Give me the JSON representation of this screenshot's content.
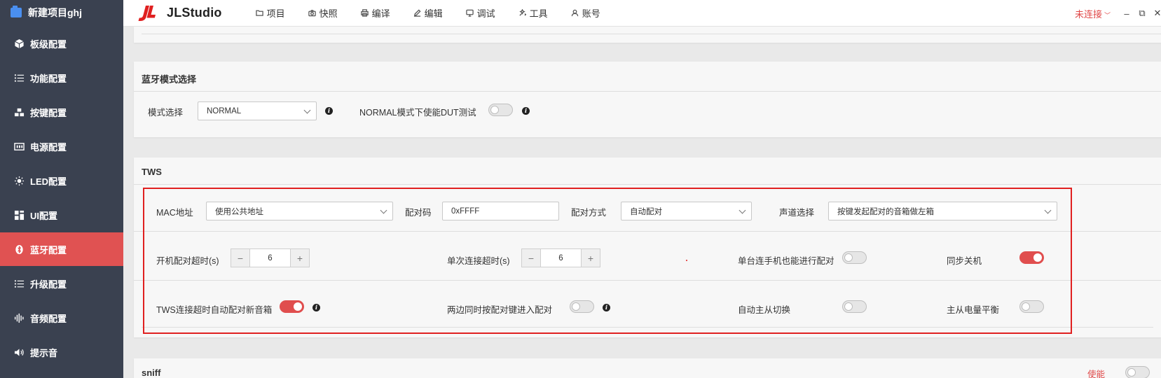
{
  "sidebar": {
    "project": "新建项目ghj",
    "items": [
      {
        "label": "板级配置",
        "icon": "cube-icon"
      },
      {
        "label": "功能配置",
        "icon": "list-icon"
      },
      {
        "label": "按键配置",
        "icon": "keys-icon"
      },
      {
        "label": "电源配置",
        "icon": "power-icon"
      },
      {
        "label": "LED配置",
        "icon": "led-icon"
      },
      {
        "label": "UI配置",
        "icon": "grid-icon"
      },
      {
        "label": "蓝牙配置",
        "icon": "bluetooth-icon",
        "active": true
      },
      {
        "label": "升级配置",
        "icon": "list-icon"
      },
      {
        "label": "音频配置",
        "icon": "audio-wave-icon"
      },
      {
        "label": "提示音",
        "icon": "speaker-icon"
      }
    ]
  },
  "header": {
    "app_name": "JLStudio",
    "menu": [
      {
        "label": "项目",
        "icon": "folder-icon"
      },
      {
        "label": "快照",
        "icon": "camera-icon"
      },
      {
        "label": "编译",
        "icon": "printer-icon"
      },
      {
        "label": "编辑",
        "icon": "pencil-icon"
      },
      {
        "label": "调试",
        "icon": "monitor-icon"
      },
      {
        "label": "工具",
        "icon": "tools-icon"
      },
      {
        "label": "账号",
        "icon": "user-icon"
      }
    ],
    "connection_status": "未连接",
    "accent_color": "#e04848"
  },
  "bt_mode": {
    "title": "蓝牙模式选择",
    "mode_label": "模式选择",
    "mode_value": "NORMAL",
    "dut_label": "NORMAL模式下使能DUT测试",
    "dut_enabled": false
  },
  "tws": {
    "title": "TWS",
    "mac_label": "MAC地址",
    "mac_value": "使用公共地址",
    "pair_code_label": "配对码",
    "pair_code_value": "0xFFFF",
    "pair_mode_label": "配对方式",
    "pair_mode_value": "自动配对",
    "channel_label": "声道选择",
    "channel_value": "按键发起配对的音箱做左箱",
    "boot_timeout_label": "开机配对超时(s)",
    "boot_timeout_value": "6",
    "single_timeout_label": "单次连接超时(s)",
    "single_timeout_value": "6",
    "single_phone_label": "单台连手机也能进行配对",
    "single_phone_enabled": false,
    "sync_off_label": "同步关机",
    "sync_off_enabled": true,
    "auto_new_label": "TWS连接超时自动配对新音箱",
    "auto_new_enabled": true,
    "both_press_label": "两边同时按配对键进入配对",
    "both_press_enabled": false,
    "auto_switch_label": "自动主从切换",
    "auto_switch_enabled": false,
    "battery_balance_label": "主从电量平衡",
    "battery_balance_enabled": false
  },
  "sniff": {
    "title": "sniff",
    "enable_label": "使能",
    "enabled": false
  },
  "icons": {
    "minimize": "–",
    "restore": "⧉",
    "close": "✕",
    "minus": "−",
    "plus": "+",
    "info": "i"
  }
}
